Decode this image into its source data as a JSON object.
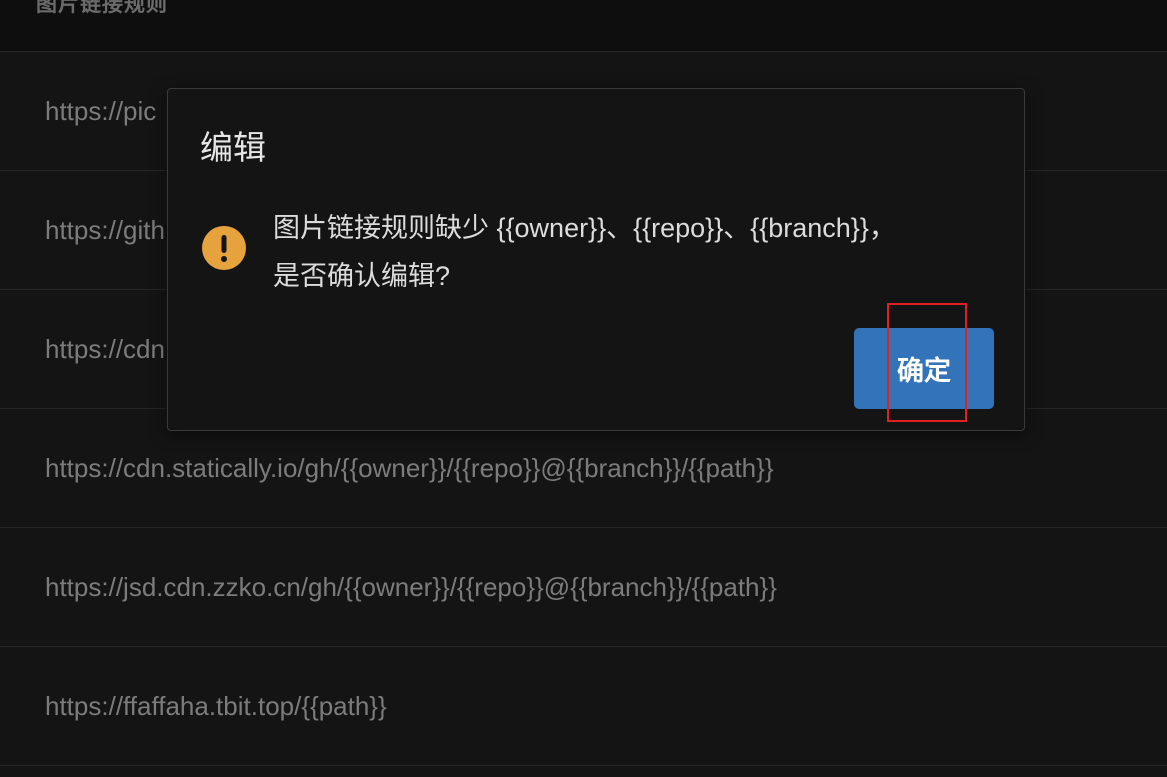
{
  "table": {
    "header": "图片链接规则",
    "rows": [
      "https://pic",
      "https://gith",
      "https://cdn",
      "https://cdn.statically.io/gh/{{owner}}/{{repo}}@{{branch}}/{{path}}",
      "https://jsd.cdn.zzko.cn/gh/{{owner}}/{{repo}}@{{branch}}/{{path}}",
      "https://ffaffaha.tbit.top/{{path}}"
    ]
  },
  "dialog": {
    "title": "编辑",
    "message_line1": "图片链接规则缺少 {{owner}}、{{repo}}、{{branch}}，",
    "message_line2": "是否确认编辑?",
    "confirm_label": "确定",
    "icon": "warning-exclamation-icon",
    "icon_color": "#e6a23c",
    "confirm_color": "#3373ba"
  },
  "colors": {
    "background": "#141414",
    "highlight": "#e02020"
  }
}
